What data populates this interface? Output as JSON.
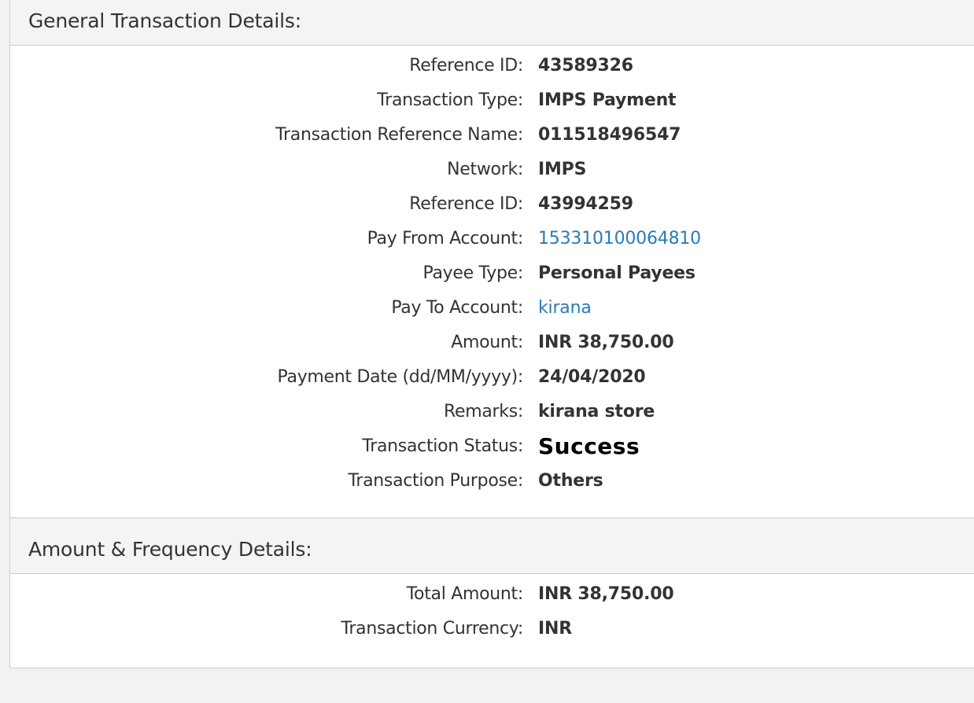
{
  "general": {
    "title": "General Transaction Details:",
    "rows": [
      {
        "label": "Reference ID:",
        "value": "43589326"
      },
      {
        "label": "Transaction Type:",
        "value": "IMPS Payment"
      },
      {
        "label": "Transaction Reference Name:",
        "value": "011518496547"
      },
      {
        "label": "Network:",
        "value": "IMPS"
      },
      {
        "label": "Reference ID:",
        "value": "43994259"
      },
      {
        "label": "Pay From Account:",
        "value": "153310100064810"
      },
      {
        "label": "Payee Type:",
        "value": "Personal Payees"
      },
      {
        "label": "Pay To Account:",
        "value": "kirana"
      },
      {
        "label": "Amount:",
        "value": "INR 38,750.00"
      },
      {
        "label": "Payment Date (dd/MM/yyyy):",
        "value": "24/04/2020"
      },
      {
        "label": "Remarks:",
        "value": "kirana store"
      },
      {
        "label": "Transaction Status:",
        "value": "Success"
      },
      {
        "label": "Transaction Purpose:",
        "value": "Others"
      }
    ]
  },
  "amount_frequency": {
    "title": "Amount & Frequency Details:",
    "rows": [
      {
        "label": "Total Amount:",
        "value": "INR 38,750.00"
      },
      {
        "label": "Transaction Currency:",
        "value": "INR"
      }
    ]
  },
  "colors": {
    "link": "#2a7ab8",
    "header_bg": "#f4f4f4",
    "border": "#cccccc"
  }
}
